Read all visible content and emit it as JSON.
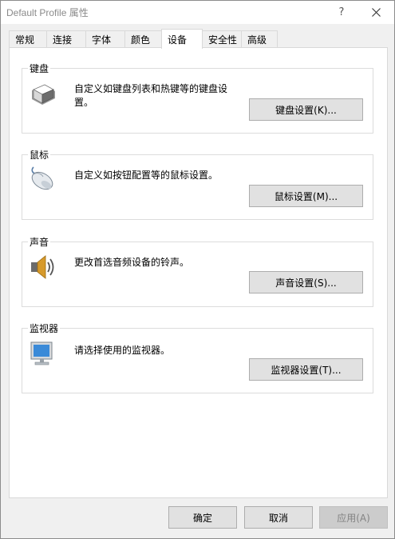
{
  "window": {
    "title": "Default Profile 属性",
    "help_glyph": "?"
  },
  "tabs": [
    {
      "label": "常规",
      "active": false
    },
    {
      "label": "连接",
      "active": false
    },
    {
      "label": "字体",
      "active": false
    },
    {
      "label": "颜色",
      "active": false
    },
    {
      "label": "设备",
      "active": true
    },
    {
      "label": "安全性",
      "active": false
    },
    {
      "label": "高级",
      "active": false
    }
  ],
  "groups": {
    "keyboard": {
      "label": "键盘",
      "description_line1": "自定义如键盘列表和热键等的键盘设",
      "description_line2": "置。",
      "button": "键盘设置(K)...",
      "icon": "keyboard-key-icon"
    },
    "mouse": {
      "label": "鼠标",
      "description": "自定义如按钮配置等的鼠标设置。",
      "button": "鼠标设置(M)...",
      "icon": "mouse-icon"
    },
    "sound": {
      "label": "声音",
      "description": "更改首选音频设备的铃声。",
      "button": "声音设置(S)...",
      "icon": "speaker-icon"
    },
    "monitor": {
      "label": "监视器",
      "description": "请选择使用的监视器。",
      "button": "监视器设置(T)...",
      "icon": "monitor-icon"
    }
  },
  "footer": {
    "ok": "确定",
    "cancel": "取消",
    "apply": "应用(A)",
    "apply_enabled": false
  },
  "colors": {
    "panel_bg": "#ffffff",
    "dialog_bg": "#f0f0f0",
    "button_bg": "#e1e1e1",
    "button_border": "#adadad",
    "disabled_bg": "#cccccc",
    "disabled_text": "#838383"
  }
}
